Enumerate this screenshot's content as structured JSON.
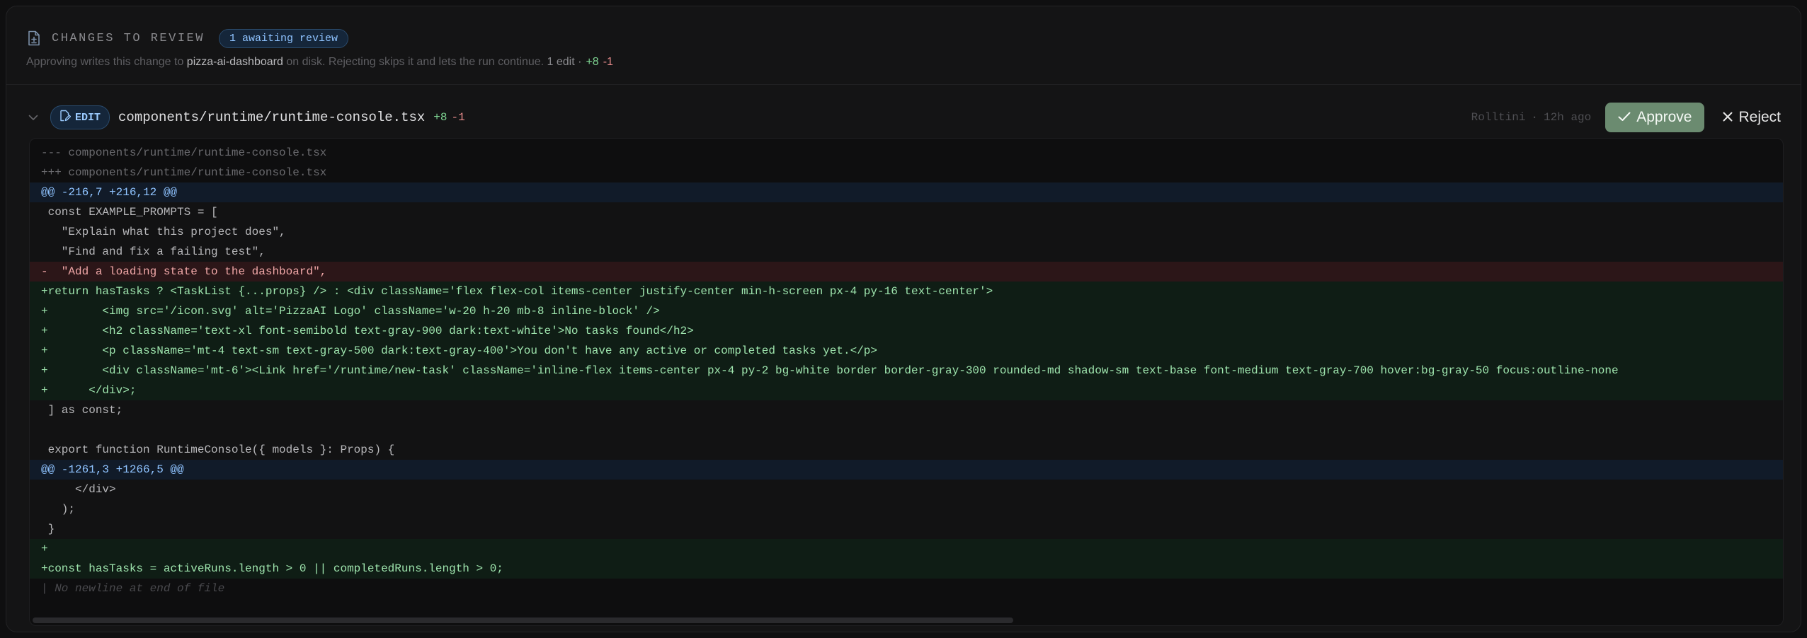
{
  "header": {
    "title": "CHANGES TO REVIEW",
    "badge": "1 awaiting review",
    "sub_prefix": "Approving writes this change to ",
    "project": "pizza-ai-dashboard",
    "sub_suffix": " on disk. Rejecting skips it and lets the run continue.",
    "edit_count": "1 edit ·",
    "additions": "+8",
    "deletions": "-1"
  },
  "file": {
    "kind": "EDIT",
    "path": "components/runtime/runtime-console.tsx",
    "additions": "+8",
    "deletions": "-1",
    "author": "Rolltini",
    "separator": "·",
    "time": "12h ago",
    "approve_label": "Approve",
    "reject_label": "Reject"
  },
  "diff": {
    "lines": [
      {
        "type": "meta-line",
        "text": "--- components/runtime/runtime-console.tsx"
      },
      {
        "type": "meta-line",
        "text": "+++ components/runtime/runtime-console.tsx"
      },
      {
        "type": "hunk",
        "text": "@@ -216,7 +216,12 @@"
      },
      {
        "type": "context",
        "text": " const EXAMPLE_PROMPTS = ["
      },
      {
        "type": "context",
        "text": "   \"Explain what this project does\","
      },
      {
        "type": "context",
        "text": "   \"Find and fix a failing test\","
      },
      {
        "type": "del",
        "text": "-  \"Add a loading state to the dashboard\","
      },
      {
        "type": "add",
        "text": "+return hasTasks ? <TaskList {...props} /> : <div className='flex flex-col items-center justify-center min-h-screen px-4 py-16 text-center'>"
      },
      {
        "type": "add",
        "text": "+        <img src='/icon.svg' alt='PizzaAI Logo' className='w-20 h-20 mb-8 inline-block' />"
      },
      {
        "type": "add",
        "text": "+        <h2 className='text-xl font-semibold text-gray-900 dark:text-white'>No tasks found</h2>"
      },
      {
        "type": "add",
        "text": "+        <p className='mt-4 text-sm text-gray-500 dark:text-gray-400'>You don't have any active or completed tasks yet.</p>"
      },
      {
        "type": "add",
        "text": "+        <div className='mt-6'><Link href='/runtime/new-task' className='inline-flex items-center px-4 py-2 bg-white border border-gray-300 rounded-md shadow-sm text-base font-medium text-gray-700 hover:bg-gray-50 focus:outline-none"
      },
      {
        "type": "add",
        "text": "+      </div>;"
      },
      {
        "type": "context",
        "text": " ] as const;"
      },
      {
        "type": "context",
        "text": " "
      },
      {
        "type": "context",
        "text": " export function RuntimeConsole({ models }: Props) {"
      },
      {
        "type": "hunk",
        "text": "@@ -1261,3 +1266,5 @@"
      },
      {
        "type": "context",
        "text": "     </div>"
      },
      {
        "type": "context",
        "text": "   );"
      },
      {
        "type": "context",
        "text": " }"
      },
      {
        "type": "add",
        "text": "+"
      },
      {
        "type": "add",
        "text": "+const hasTasks = activeRuns.length > 0 || completedRuns.length > 0;"
      },
      {
        "type": "note",
        "text": "| No newline at end of file"
      }
    ]
  }
}
